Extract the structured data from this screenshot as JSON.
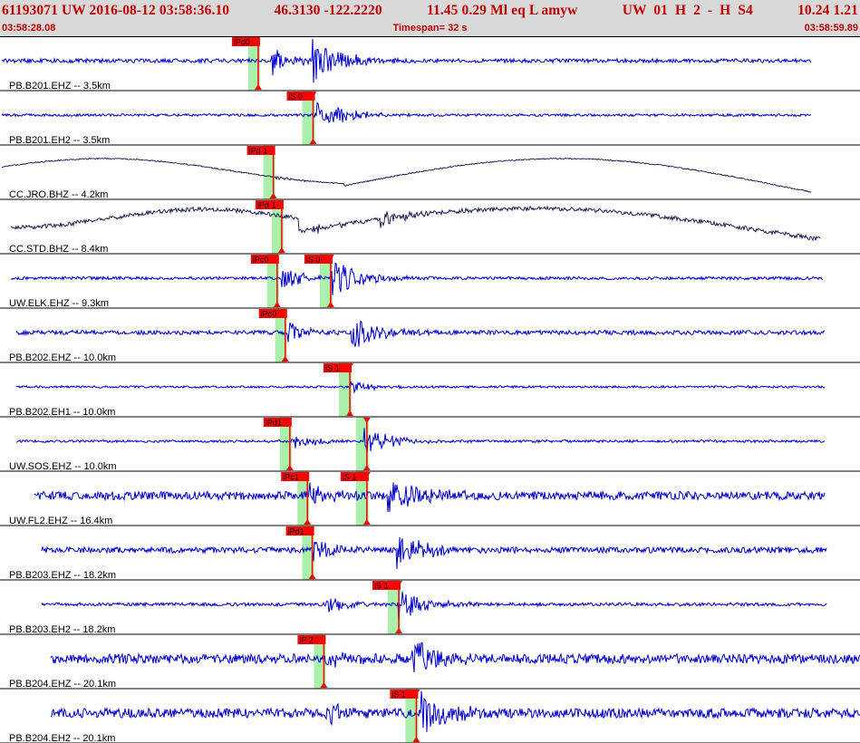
{
  "header": {
    "title_fields": [
      "61193071",
      "UW",
      "2016-08-12",
      "03:58:36.10",
      "46.3130",
      "-122.2220",
      "11.45",
      "0.29",
      "Ml",
      "eq",
      "L",
      "amyw",
      "UW",
      "01",
      "H",
      "2",
      "-",
      "H",
      "S4",
      "10.24",
      "1.21"
    ],
    "start_time": "03:58:28.08",
    "timespan": "Timespan=  32 s",
    "end_time": "03:58:59.89"
  },
  "colors": {
    "header_bg": "#d9d9d9",
    "header_text": "#c00000",
    "trace": "#0000cc",
    "trace_dark": "#10104a",
    "pick": "#ff0000",
    "pick_window": "#aaf0aa",
    "label": "#000000"
  },
  "time_axis": {
    "start_s": 0,
    "end_s": 31.81
  },
  "traces": [
    {
      "label": "PB.B201.EHZ -- 3.5km",
      "picks": [
        {
          "label": "iPd0",
          "type": "P",
          "t": 9.55
        }
      ]
    },
    {
      "label": "PB.B201.EH2 -- 3.5km",
      "picks": [
        {
          "label": "iS 0",
          "type": "S",
          "t": 11.58
        }
      ]
    },
    {
      "label": "CC.JRO.BHZ -- 4.2km",
      "picks": [
        {
          "label": "iPd 1",
          "type": "P",
          "t": 10.11
        }
      ]
    },
    {
      "label": "CC.STD.BHZ -- 8.4km",
      "picks": [
        {
          "label": "iPd 1",
          "type": "P",
          "t": 10.42
        }
      ]
    },
    {
      "label": "UW.ELK.EHZ -- 9.3km",
      "picks": [
        {
          "label": "iPc0",
          "type": "P",
          "t": 10.25
        },
        {
          "label": "iS 0",
          "type": "S",
          "t": 12.23
        }
      ]
    },
    {
      "label": "PB.B202.EHZ -- 10.0km",
      "picks": [
        {
          "label": "iPc0",
          "type": "P",
          "t": 10.55
        }
      ]
    },
    {
      "label": "PB.B202.EH1 -- 10.0km",
      "picks": [
        {
          "label": "iS 1",
          "type": "S",
          "t": 12.94
        }
      ]
    },
    {
      "label": "UW.SOS.EHZ -- 10.0km",
      "picks": [
        {
          "label": "iPd1",
          "type": "P",
          "t": 10.72
        },
        {
          "label": "",
          "type": "S",
          "t": 13.57
        }
      ]
    },
    {
      "label": "UW.FL2.EHZ -- 16.4km",
      "picks": [
        {
          "label": "iPc1",
          "type": "P",
          "t": 11.37
        },
        {
          "label": "iS 1",
          "type": "S",
          "t": 13.57
        }
      ]
    },
    {
      "label": "PB.B203.EHZ -- 18.2km",
      "picks": [
        {
          "label": "iPd1",
          "type": "P",
          "t": 11.55
        }
      ]
    },
    {
      "label": "PB.B203.EH2 -- 18.2km",
      "picks": [
        {
          "label": "iS 1",
          "type": "S",
          "t": 14.75
        }
      ]
    },
    {
      "label": "PB.B204.EHZ -- 20.1km",
      "picks": [
        {
          "label": "iP 2",
          "type": "P",
          "t": 11.98
        }
      ]
    },
    {
      "label": "PB.B204.EH2 -- 20.1km",
      "picks": [
        {
          "label": "iS 1",
          "type": "S",
          "t": 15.4
        }
      ]
    }
  ]
}
